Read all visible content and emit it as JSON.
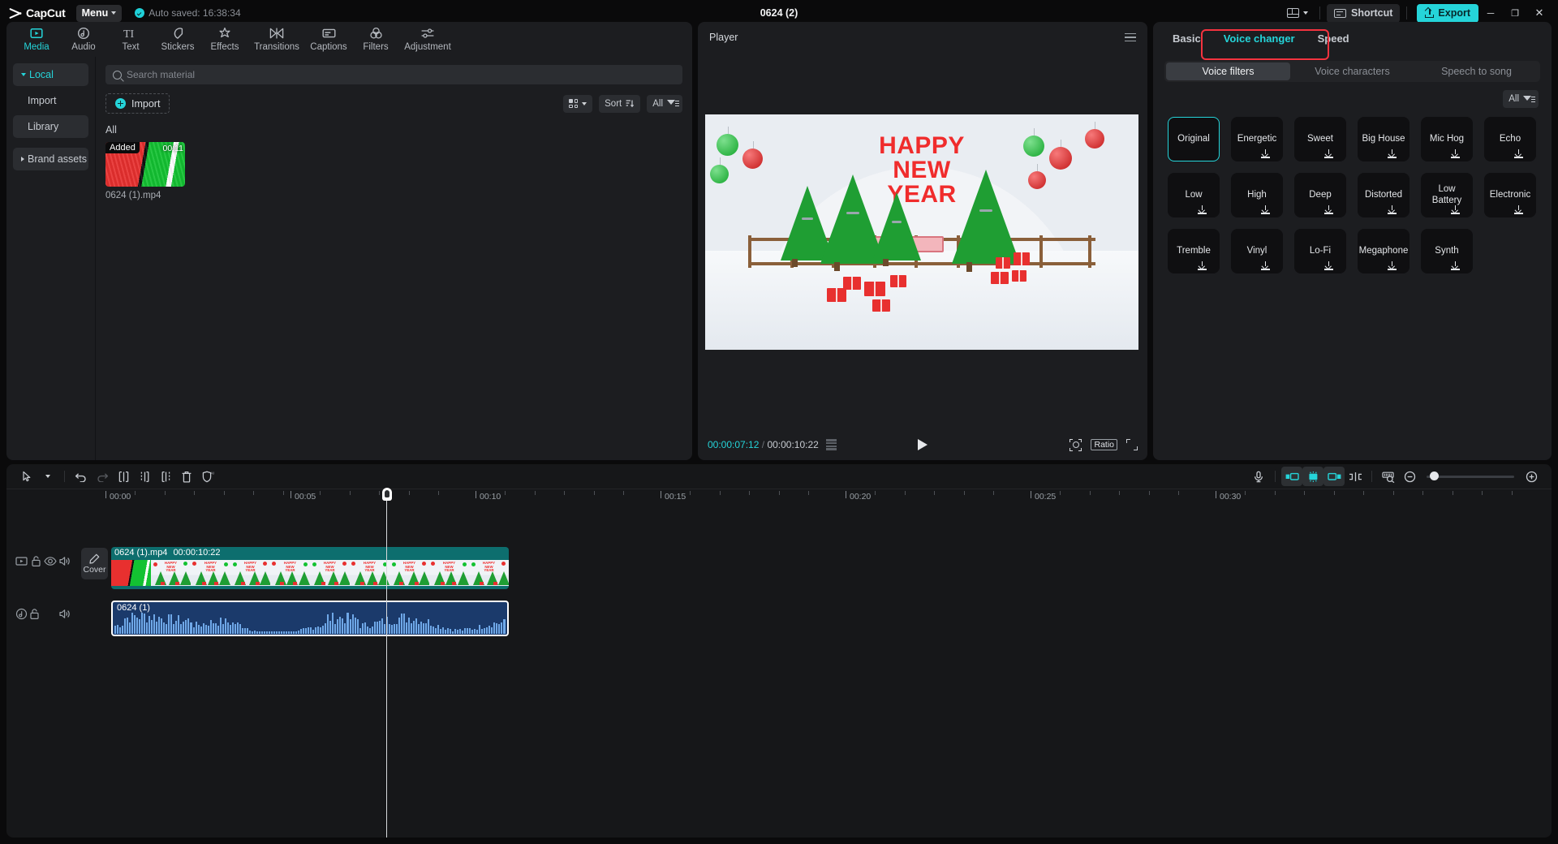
{
  "topbar": {
    "app_name": "CapCut",
    "menu_label": "Menu",
    "autosave_text": "Auto saved: 16:38:34",
    "project_title": "0624 (2)",
    "layout_icon": "layout-icon",
    "shortcut_label": "Shortcut",
    "export_label": "Export",
    "minimize_glyph": "─",
    "maximize_glyph": "❐",
    "close_glyph": "✕"
  },
  "nav_tabs": [
    {
      "label": "Media",
      "icon": "media-icon",
      "active": true
    },
    {
      "label": "Audio",
      "icon": "audio-icon",
      "active": false
    },
    {
      "label": "Text",
      "icon": "text-icon",
      "active": false
    },
    {
      "label": "Stickers",
      "icon": "stickers-icon",
      "active": false
    },
    {
      "label": "Effects",
      "icon": "effects-icon",
      "active": false
    },
    {
      "label": "Transitions",
      "icon": "transitions-icon",
      "active": false
    },
    {
      "label": "Captions",
      "icon": "captions-icon",
      "active": false
    },
    {
      "label": "Filters",
      "icon": "filters-icon",
      "active": false
    },
    {
      "label": "Adjustment",
      "icon": "adjustment-icon",
      "active": false
    }
  ],
  "subnav": [
    {
      "label": "Local",
      "state": "selected"
    },
    {
      "label": "Import",
      "state": "plain"
    },
    {
      "label": "Library",
      "state": "grey"
    },
    {
      "label": "Brand assets",
      "state": "grey"
    }
  ],
  "media": {
    "search_placeholder": "Search material",
    "import_label": "Import",
    "view_label": "",
    "sort_label": "Sort",
    "filter_label": "All",
    "group_label": "All",
    "items": [
      {
        "name": "0624 (1).mp4",
        "badge": "Added",
        "duration": "00:11"
      }
    ]
  },
  "player": {
    "title": "Player",
    "current_time": "00:00:07:12",
    "total_time": "00:00:10:22",
    "separator": "/",
    "ratio_label": "Ratio",
    "canvas_text_line1": "HAPPY",
    "canvas_text_line2": "NEW",
    "canvas_text_line3": "YEAR"
  },
  "right_panel": {
    "tabs": [
      {
        "label": "Basic",
        "active": false
      },
      {
        "label": "Voice changer",
        "active": true
      },
      {
        "label": "Speed",
        "active": false
      }
    ],
    "segments": [
      {
        "label": "Voice filters",
        "active": true
      },
      {
        "label": "Voice characters",
        "active": false
      },
      {
        "label": "Speech to song",
        "active": false
      }
    ],
    "filter_chip": "All",
    "voice_filters": [
      {
        "label": "Original",
        "selected": true,
        "download": false
      },
      {
        "label": "Energetic",
        "selected": false,
        "download": true
      },
      {
        "label": "Sweet",
        "selected": false,
        "download": true
      },
      {
        "label": "Big House",
        "selected": false,
        "download": true
      },
      {
        "label": "Mic Hog",
        "selected": false,
        "download": true
      },
      {
        "label": "Echo",
        "selected": false,
        "download": true
      },
      {
        "label": "Low",
        "selected": false,
        "download": true
      },
      {
        "label": "High",
        "selected": false,
        "download": true
      },
      {
        "label": "Deep",
        "selected": false,
        "download": true
      },
      {
        "label": "Distorted",
        "selected": false,
        "download": true
      },
      {
        "label": "Low Battery",
        "selected": false,
        "download": true
      },
      {
        "label": "Electronic",
        "selected": false,
        "download": true
      },
      {
        "label": "Tremble",
        "selected": false,
        "download": true
      },
      {
        "label": "Vinyl",
        "selected": false,
        "download": true
      },
      {
        "label": "Lo-Fi",
        "selected": false,
        "download": true
      },
      {
        "label": "Megaphone",
        "selected": false,
        "download": true
      },
      {
        "label": "Synth",
        "selected": false,
        "download": true
      }
    ]
  },
  "timeline": {
    "tools_left": [
      {
        "name": "select-tool",
        "state": "normal"
      },
      {
        "name": "undo-tool",
        "state": "normal"
      },
      {
        "name": "redo-tool",
        "state": "disabled"
      },
      {
        "name": "split-tool",
        "state": "normal"
      },
      {
        "name": "trim-left-tool",
        "state": "normal"
      },
      {
        "name": "trim-right-tool",
        "state": "normal"
      },
      {
        "name": "delete-tool",
        "state": "normal"
      },
      {
        "name": "ai-shield-tool",
        "state": "normal"
      }
    ],
    "tools_right": [
      {
        "name": "record-voiceover-tool",
        "state": "normal"
      },
      {
        "name": "snap-left-tool",
        "state": "on"
      },
      {
        "name": "snap-center-tool",
        "state": "on"
      },
      {
        "name": "snap-right-tool",
        "state": "on"
      },
      {
        "name": "marker-tool",
        "state": "normal"
      },
      {
        "name": "zoom-fit-tool",
        "state": "normal"
      },
      {
        "name": "zoom-out-tool",
        "state": "normal"
      },
      {
        "name": "zoom-in-tool",
        "state": "normal"
      }
    ],
    "ruler_labels": [
      "00:00",
      "00:05",
      "00:10",
      "00:15",
      "00:20",
      "00:25",
      "00:30"
    ],
    "cover_label": "Cover",
    "video_clip": {
      "name": "0624 (1).mp4",
      "duration": "00:00:10:22"
    },
    "audio_clip": {
      "name": "0624 (1)",
      "selected": true
    }
  }
}
